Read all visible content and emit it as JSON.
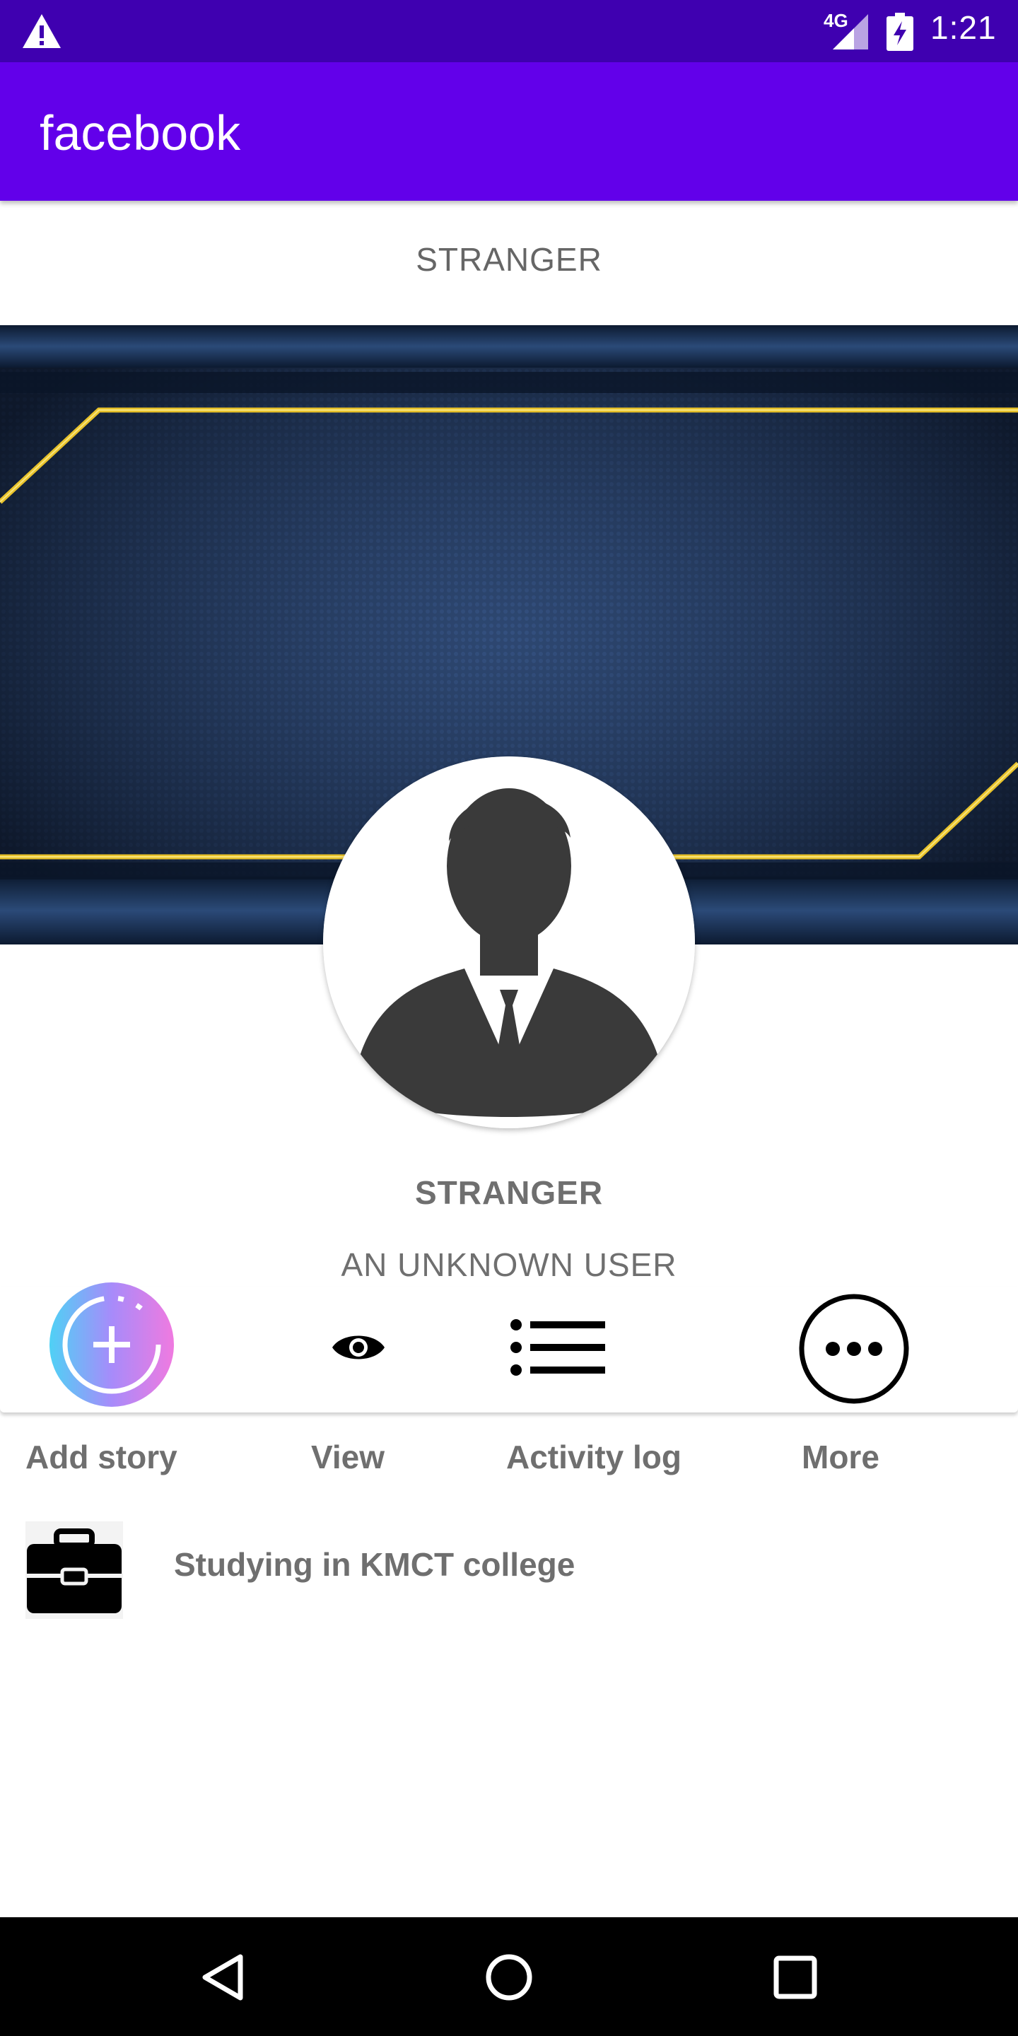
{
  "status_bar": {
    "network": "4G",
    "time": "1:21",
    "icons": [
      "warning-icon",
      "signal-icon",
      "battery-charging-icon"
    ]
  },
  "app_bar": {
    "title": "facebook"
  },
  "profile": {
    "header_name": "STRANGER",
    "name": "STRANGER",
    "bio": "AN UNKNOWN USER"
  },
  "actions": [
    {
      "label": "Add story",
      "icon": "add-story-icon"
    },
    {
      "label": "View",
      "icon": "eye-icon"
    },
    {
      "label": "Activity log",
      "icon": "list-icon"
    },
    {
      "label": "More",
      "icon": "more-icon"
    }
  ],
  "work": {
    "text": "Studying in KMCT college",
    "icon": "briefcase-icon"
  },
  "nav": {
    "icons": [
      "back-icon",
      "home-icon",
      "recents-icon"
    ]
  },
  "colors": {
    "status_bar": "#3f00b0",
    "app_bar": "#6200ea",
    "text_gray": "#6f6f6f"
  }
}
